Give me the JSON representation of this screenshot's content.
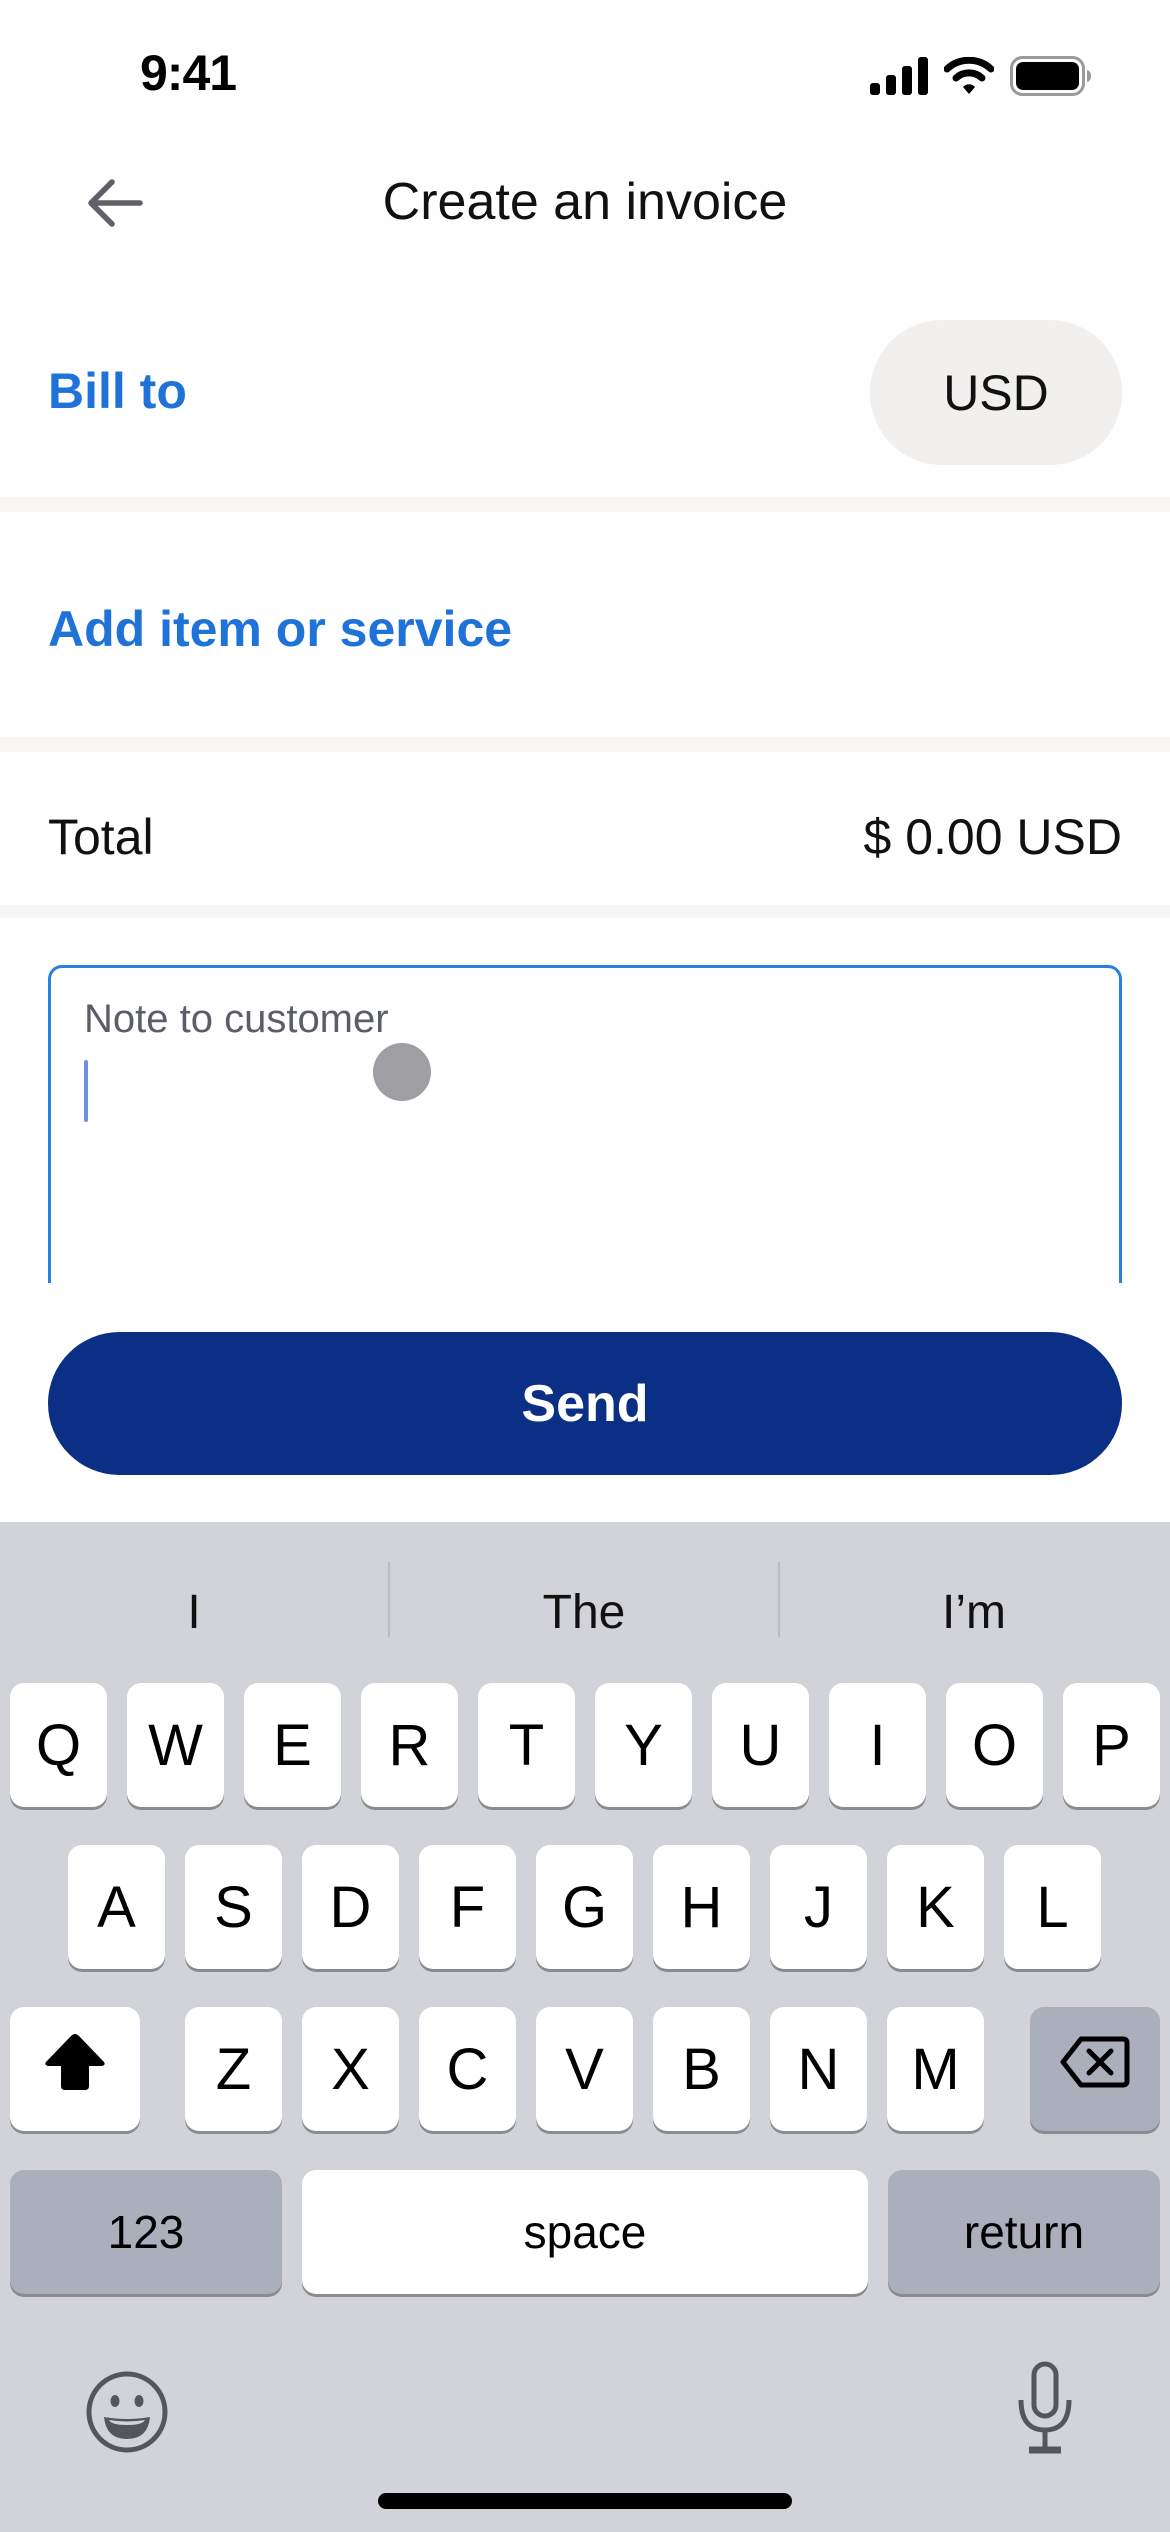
{
  "status_bar": {
    "time": "9:41",
    "icons": [
      "cellular-signal-icon",
      "wifi-icon",
      "battery-icon"
    ]
  },
  "header": {
    "back_icon": "arrow-left-icon",
    "title": "Create an invoice"
  },
  "bill_to": {
    "label": "Bill to",
    "currency": "USD"
  },
  "items": {
    "add_label": "Add item or service"
  },
  "total": {
    "label": "Total",
    "value": "$ 0.00 USD"
  },
  "note": {
    "label": "Note to customer",
    "value": ""
  },
  "send_button": {
    "label": "Send"
  },
  "colors": {
    "link_blue": "#1f72d8",
    "primary_button": "#0a2f84",
    "focus_border": "#2a7fe0",
    "keyboard_bg": "#d2d3d8"
  },
  "keyboard": {
    "suggestions": [
      "I",
      "The",
      "I’m"
    ],
    "row1": [
      "Q",
      "W",
      "E",
      "R",
      "T",
      "Y",
      "U",
      "I",
      "O",
      "P"
    ],
    "row2": [
      "A",
      "S",
      "D",
      "F",
      "G",
      "H",
      "J",
      "K",
      "L"
    ],
    "row3": [
      "Z",
      "X",
      "C",
      "V",
      "B",
      "N",
      "M"
    ],
    "numbers_label": "123",
    "space_label": "space",
    "return_label": "return",
    "shift_icon": "shift-icon",
    "delete_icon": "backspace-icon",
    "emoji_icon": "emoji-icon",
    "mic_icon": "microphone-icon"
  }
}
